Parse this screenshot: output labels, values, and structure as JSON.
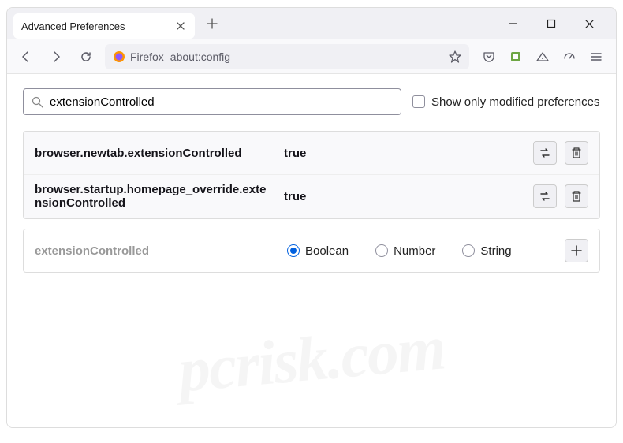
{
  "window": {
    "tab_title": "Advanced Preferences"
  },
  "toolbar": {
    "identity_label": "Firefox",
    "url": "about:config"
  },
  "content": {
    "search_value": "extensionControlled",
    "checkbox_label": "Show only modified preferences",
    "preferences": [
      {
        "name": "browser.newtab.extensionControlled",
        "value": "true"
      },
      {
        "name": "browser.startup.homepage_override.extensionControlled",
        "value": "true"
      }
    ],
    "new_pref": {
      "name": "extensionControlled",
      "types": [
        "Boolean",
        "Number",
        "String"
      ],
      "selected": "Boolean"
    }
  },
  "watermark": "pcrisk.com"
}
